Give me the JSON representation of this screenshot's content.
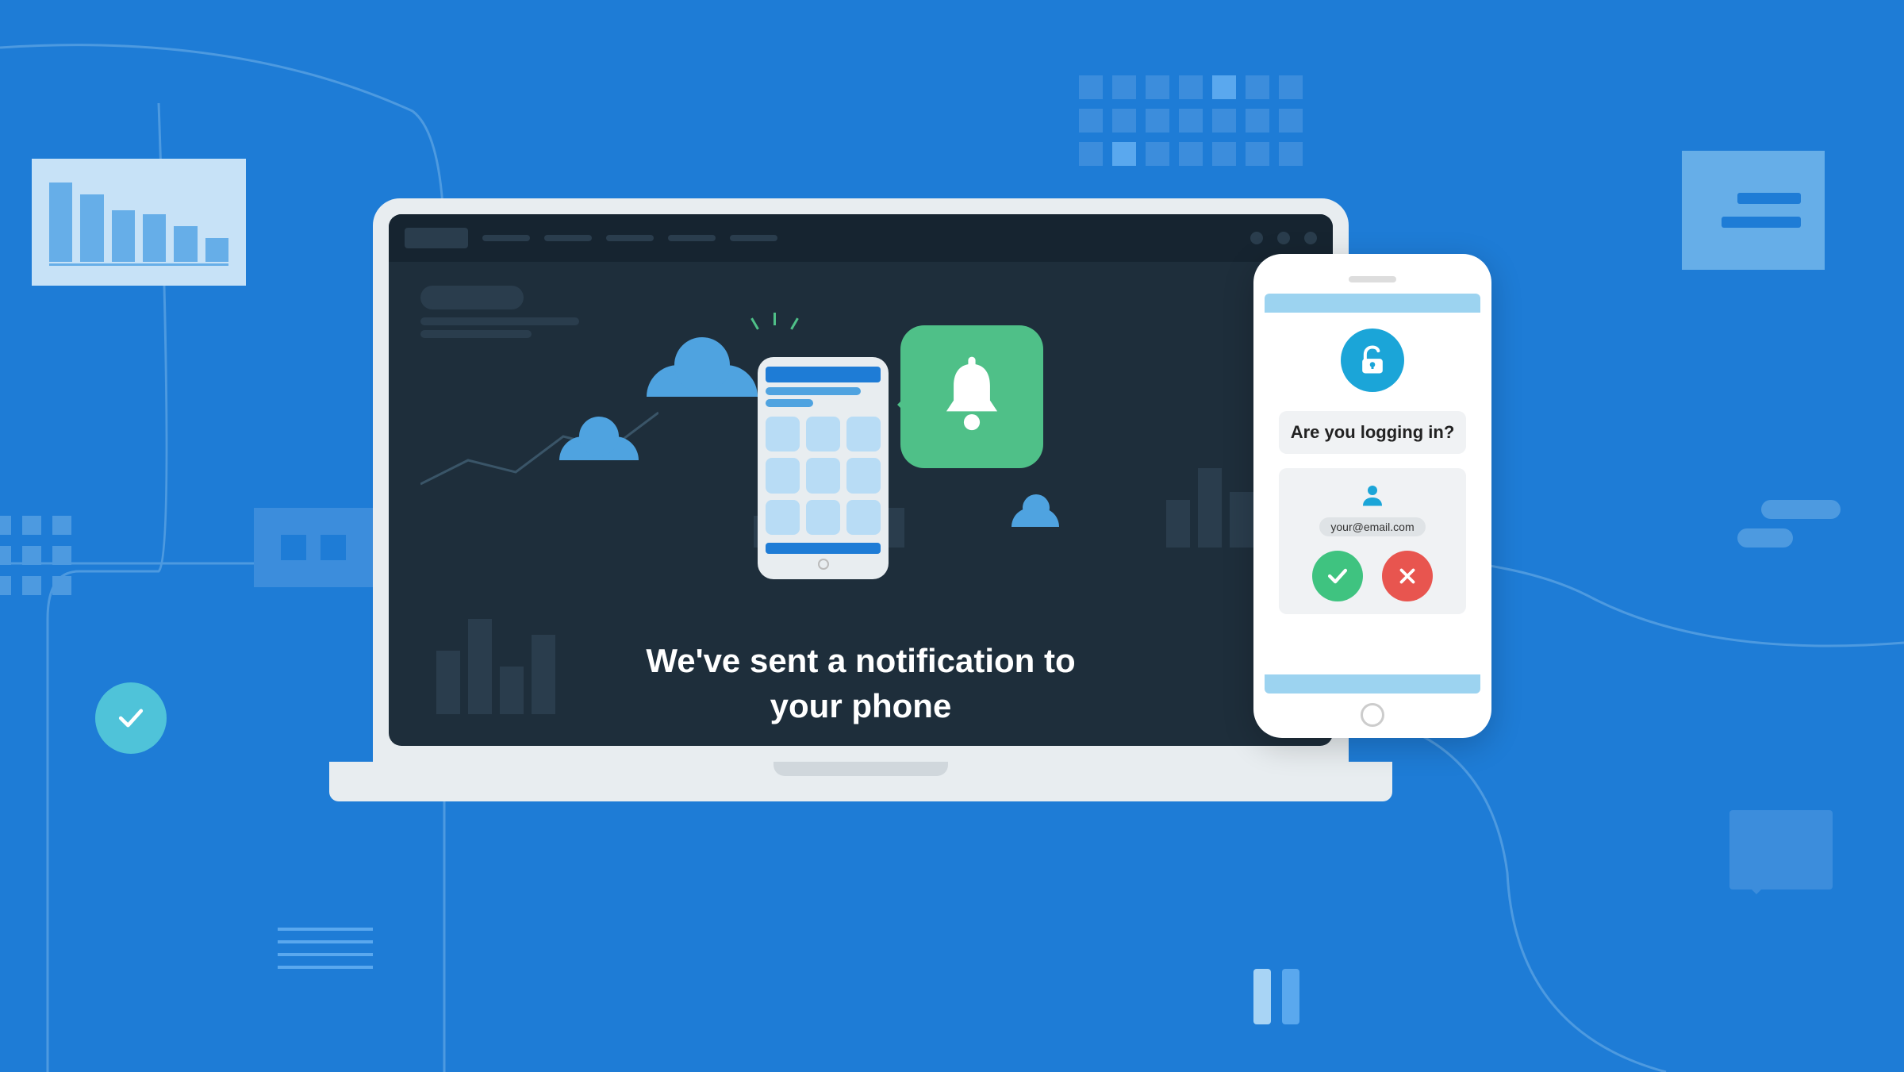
{
  "laptop": {
    "notification_text_line1": "We've sent a notification to",
    "notification_text_line2": "your phone"
  },
  "phone": {
    "prompt": "Are you logging in?",
    "email": "your@email.com"
  },
  "icons": {
    "bell": "bell-icon",
    "lock": "unlock-icon",
    "user": "user-icon",
    "check": "check-icon",
    "cross": "cross-icon"
  }
}
